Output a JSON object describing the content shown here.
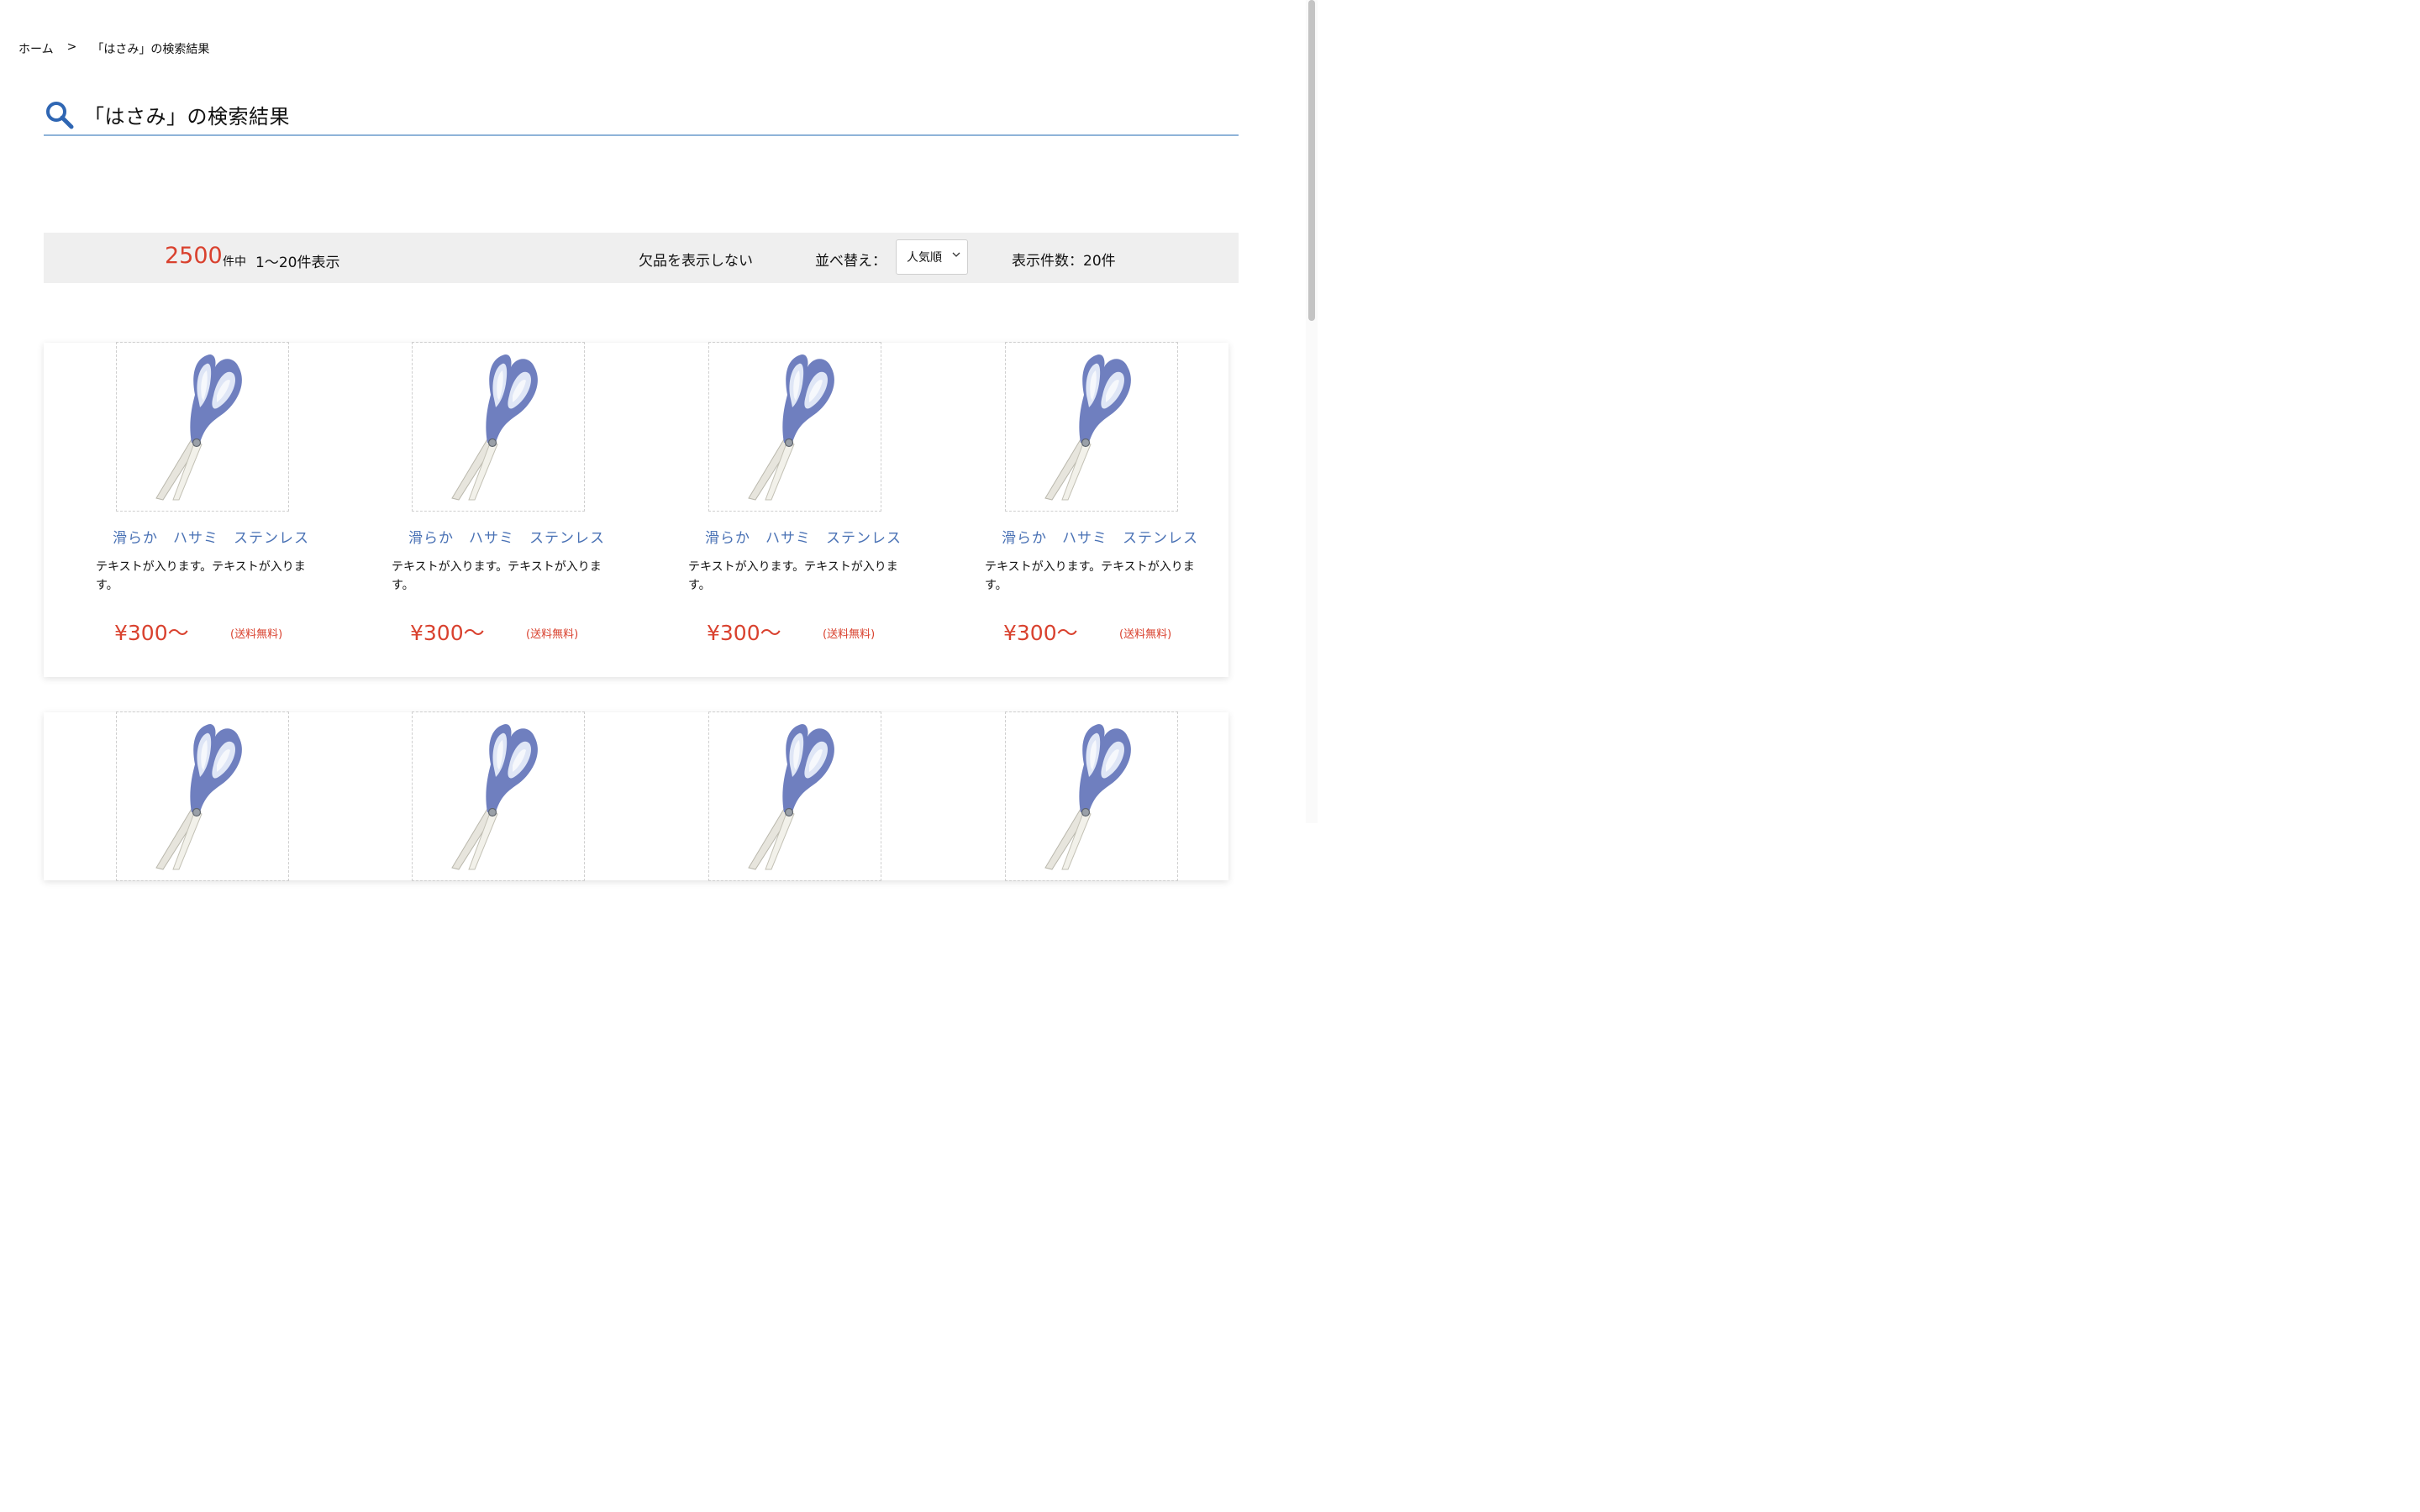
{
  "breadcrumb": {
    "home": "ホーム",
    "separator": ">",
    "current": "「はさみ」の検索結果"
  },
  "search": {
    "title": "「はさみ」の検索結果",
    "icon": "search-icon"
  },
  "toolbar": {
    "count": "2500",
    "count_unit": "件中",
    "range": "1〜20件表示",
    "hide_out_of_stock": "欠品を表示しない",
    "sort_label": "並べ替え：",
    "sort_value": "人気順",
    "per_page": "表示件数：20件"
  },
  "products": [
    {
      "name": "滑らか　ハサミ　ステンレス",
      "description": "テキストが入ります。テキストが入ります。",
      "price": "¥300〜",
      "shipping": "(送料無料)",
      "icon": "scissors-icon"
    },
    {
      "name": "滑らか　ハサミ　ステンレス",
      "description": "テキストが入ります。テキストが入ります。",
      "price": "¥300〜",
      "shipping": "(送料無料)",
      "icon": "scissors-icon"
    },
    {
      "name": "滑らか　ハサミ　ステンレス",
      "description": "テキストが入ります。テキストが入ります。",
      "price": "¥300〜",
      "shipping": "(送料無料)",
      "icon": "scissors-icon"
    },
    {
      "name": "滑らか　ハサミ　ステンレス",
      "description": "テキストが入ります。テキストが入ります。",
      "price": "¥300〜",
      "shipping": "(送料無料)",
      "icon": "scissors-icon"
    }
  ],
  "colors": {
    "accent_red": "#d9412e",
    "link_blue": "#4a72b5",
    "underline": "#8fb4d9"
  }
}
